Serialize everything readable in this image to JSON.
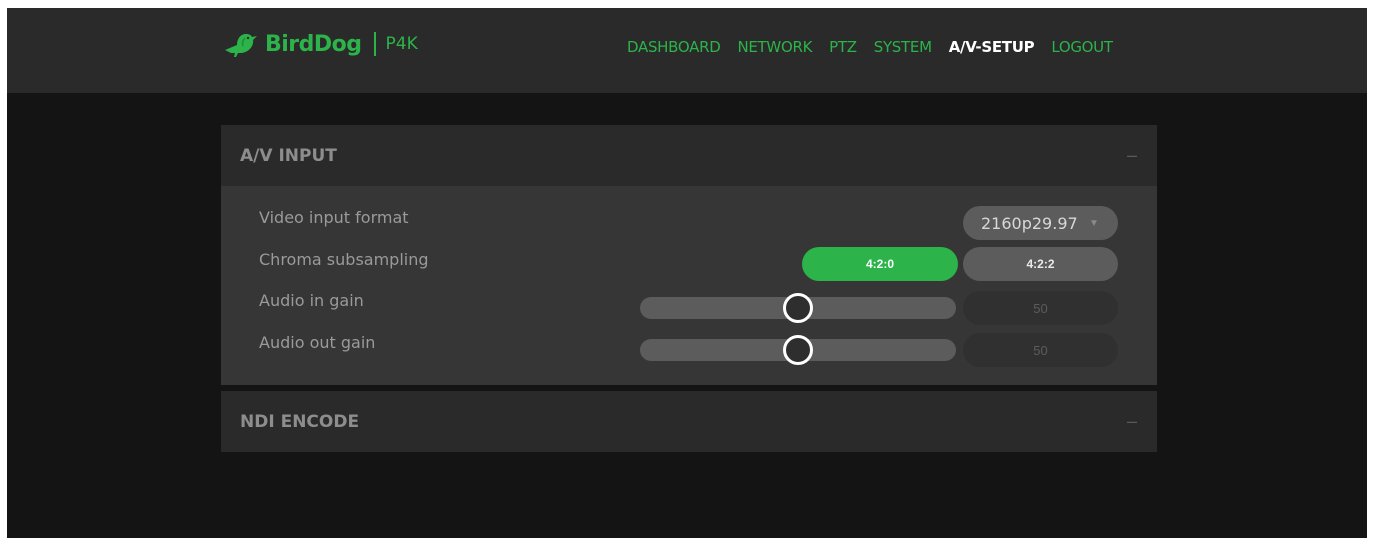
{
  "brand": {
    "name": "BirdDog",
    "model": "P4K"
  },
  "nav": [
    {
      "label": "DASHBOARD",
      "active": false
    },
    {
      "label": "NETWORK",
      "active": false
    },
    {
      "label": "PTZ",
      "active": false
    },
    {
      "label": "SYSTEM",
      "active": false
    },
    {
      "label": "A/V-SETUP",
      "active": true
    },
    {
      "label": "LOGOUT",
      "active": false
    }
  ],
  "av_input": {
    "title": "A/V INPUT",
    "collapse_symbol": "–",
    "video_input_format": {
      "label": "Video input format",
      "value": "2160p29.97",
      "arrow": "▼"
    },
    "chroma_subsampling": {
      "label": "Chroma subsampling",
      "options": [
        "4:2:0",
        "4:2:2"
      ],
      "selected": "4:2:0"
    },
    "audio_in_gain": {
      "label": "Audio in gain",
      "value": "50",
      "level": 0.5
    },
    "audio_out_gain": {
      "label": "Audio out gain",
      "value": "50",
      "level": 0.5
    }
  },
  "ndi_encode": {
    "title": "NDI ENCODE",
    "collapse_symbol": "–"
  },
  "colors": {
    "accent": "#2cb34a",
    "panel": "#2a2a2a",
    "panel_body": "#363636",
    "background": "#141414"
  }
}
